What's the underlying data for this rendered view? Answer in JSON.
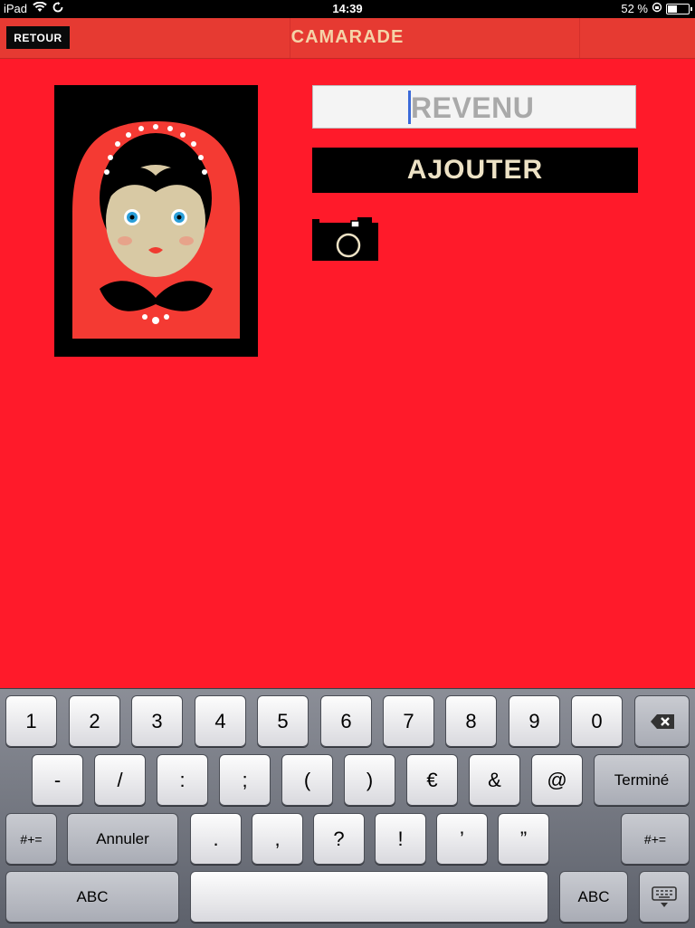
{
  "status": {
    "device": "iPad",
    "time": "14:39",
    "battery": "52 %",
    "battery_level": 0.52
  },
  "nav": {
    "back_label": "RETOUR",
    "title": "CAMARADE"
  },
  "form": {
    "input_placeholder": "REVENU",
    "add_label": "AJOUTER"
  },
  "keyboard": {
    "row1": [
      "1",
      "2",
      "3",
      "4",
      "5",
      "6",
      "7",
      "8",
      "9",
      "0"
    ],
    "row2": [
      "-",
      "/",
      ":",
      ";",
      "(",
      ")",
      "€",
      "&",
      "@",
      "Terminé"
    ],
    "row3": [
      "#+=",
      "Annuler",
      ".",
      ",",
      "?",
      "!",
      "’",
      "”",
      "#+="
    ],
    "row4": [
      "ABC",
      "ABC"
    ]
  },
  "colors": {
    "background": "#ff1a2a",
    "navbar": "#e63a32",
    "title": "#f5d3a8",
    "button_text": "#ede2c5"
  },
  "icons": [
    "wifi-icon",
    "sync-icon",
    "lock-rotation-icon",
    "battery-icon",
    "camera-icon",
    "delete-icon",
    "keyboard-dismiss-icon"
  ]
}
